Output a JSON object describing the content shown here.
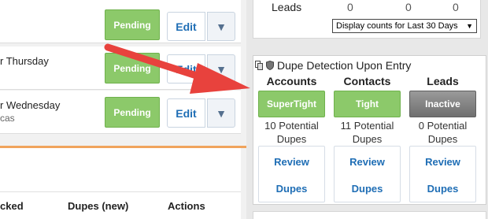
{
  "left": {
    "rows": [
      {
        "text": "",
        "sub": "",
        "pending": "Pending",
        "edit": "Edit"
      },
      {
        "text": "r Thursday",
        "sub": "",
        "pending": "Pending",
        "edit": "Edit"
      },
      {
        "text": "r Wednesday",
        "sub": "cas",
        "pending": "Pending",
        "edit": "Edit"
      }
    ],
    "columns": [
      "cked",
      "Dupes (new)",
      "Actions"
    ]
  },
  "counts": {
    "label": "Leads",
    "values": [
      "0",
      "0",
      "0"
    ],
    "select_value": "Display counts for Last 30 Days"
  },
  "dupe_detection": {
    "title": "Dupe Detection Upon Entry",
    "columns": [
      {
        "heading": "Accounts",
        "status": "SuperTight",
        "potential_line1": "10 Potential",
        "potential_line2": "Dupes",
        "review_line1": "Review",
        "review_line2": "Dupes",
        "status_color": "#8cc96a"
      },
      {
        "heading": "Contacts",
        "status": "Tight",
        "potential_line1": "11 Potential",
        "potential_line2": "Dupes",
        "review_line1": "Review",
        "review_line2": "Dupes",
        "status_color": "#8cc96a"
      },
      {
        "heading": "Leads",
        "status": "Inactive",
        "potential_line1": "0 Potential",
        "potential_line2": "Dupes",
        "review_line1": "Review",
        "review_line2": "Dupes",
        "status_color": "#7d7d7d"
      }
    ]
  },
  "colors": {
    "accent_red": "#e8423d",
    "link_blue": "#1f6eb5",
    "pending_green": "#8cc96a",
    "divider_orange": "#f0a35c"
  },
  "icons": {
    "arrow": "red-pointer-arrow",
    "menu": "caret-down-icon",
    "dupe_title": "dupe-detection-icons"
  }
}
